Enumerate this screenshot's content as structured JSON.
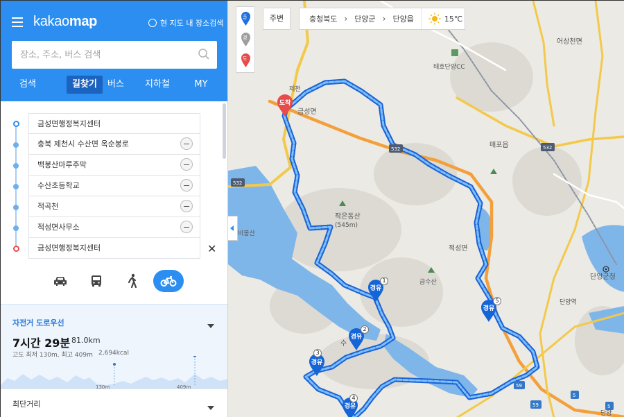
{
  "app": {
    "logo_light": "kakao",
    "logo_bold": "map",
    "map_search_label": "현 지도 내 장소검색"
  },
  "search": {
    "placeholder": "장소, 주소, 버스 검색"
  },
  "tabs": [
    "검색",
    "길찾기",
    "버스",
    "지하철",
    "MY"
  ],
  "active_tab": "길찾기",
  "waypoints": [
    {
      "label": "금성면행정복지센터",
      "kind": "start"
    },
    {
      "label": "충북 제천시 수산면 옥순봉로",
      "kind": "via"
    },
    {
      "label": "백봉산마루주막",
      "kind": "via"
    },
    {
      "label": "수산초등학교",
      "kind": "via"
    },
    {
      "label": "적곡천",
      "kind": "via"
    },
    {
      "label": "적성면사무소",
      "kind": "via"
    },
    {
      "label": "금성면행정복지센터",
      "kind": "end"
    }
  ],
  "transport_modes": [
    {
      "name": "car",
      "active": false
    },
    {
      "name": "bus",
      "active": false
    },
    {
      "name": "walk",
      "active": false
    },
    {
      "name": "bicycle",
      "active": true
    }
  ],
  "route_primary": {
    "label": "자전거 도로우선",
    "time": "7시간 29분",
    "distance": "81.0km",
    "elevation": "고도 최저 130m, 최고 409m",
    "calories": "2,694kcal",
    "marker_low": "130m",
    "marker_high": "409m"
  },
  "route_secondary": {
    "label": "최단거리"
  },
  "map": {
    "nearby_button": "주변",
    "breadcrumbs": [
      "충청북도",
      "단양군",
      "단양읍"
    ],
    "temperature": "15℃",
    "marker_start": "출",
    "marker_via": "경",
    "marker_end": "도",
    "arrive_label": "도착",
    "via_label": "경유",
    "via_numbers": [
      "1",
      "2",
      "3",
      "4",
      "5"
    ],
    "place_labels": [
      "제천",
      "금성면",
      "태호단양CC",
      "어상천면",
      "매포읍",
      "작은동산",
      "(545m)",
      "적성면",
      "금수산",
      "수",
      "단양군청",
      "단양역",
      "비봉산",
      "단양"
    ],
    "road_numbers": [
      "532",
      "532",
      "532",
      "59",
      "59",
      "5",
      "5"
    ],
    "route_color": "#3d8ef5",
    "water_color": "#7fb6e9"
  },
  "colors": {
    "accent": "#2b8ef0",
    "active_tab_bg": "#1c62bf",
    "end_marker": "#e84b4b"
  }
}
